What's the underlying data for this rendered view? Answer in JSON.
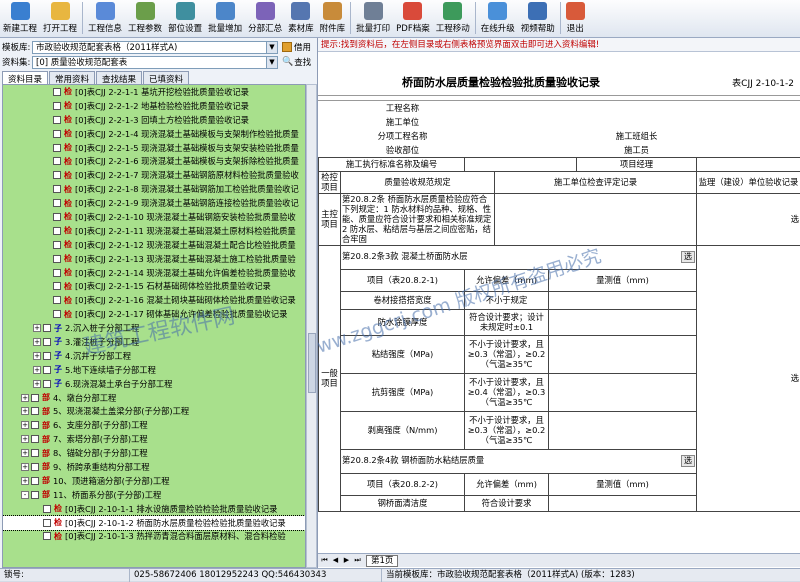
{
  "toolbar": [
    {
      "label": "新建工程",
      "icon": "new-project-icon",
      "color": "#3a7fd0"
    },
    {
      "label": "打开工程",
      "icon": "open-folder-icon",
      "color": "#e8b640"
    },
    {
      "label": "工程信息",
      "icon": "project-info-icon",
      "color": "#5a8ad8"
    },
    {
      "label": "工程参数",
      "icon": "project-params-icon",
      "color": "#6b9e4a"
    },
    {
      "label": "部位设置",
      "icon": "location-settings-icon",
      "color": "#3f8f9f"
    },
    {
      "label": "批量增加",
      "icon": "batch-add-icon",
      "color": "#4c86c9"
    },
    {
      "label": "分部汇总",
      "icon": "summary-icon",
      "color": "#7c63b8"
    },
    {
      "label": "素材库",
      "icon": "material-library-icon",
      "color": "#5576b0"
    },
    {
      "label": "附件库",
      "icon": "attachment-library-icon",
      "color": "#c88b3a"
    },
    {
      "label": "批量打印",
      "icon": "batch-print-icon",
      "color": "#6f7f96"
    },
    {
      "label": "PDF档案",
      "icon": "pdf-icon",
      "color": "#d94a3a"
    },
    {
      "label": "工程移动",
      "icon": "project-move-icon",
      "color": "#3d9a5b"
    },
    {
      "label": "在线升级",
      "icon": "online-upgrade-icon",
      "color": "#4a90d9"
    },
    {
      "label": "视频帮助",
      "icon": "video-help-icon",
      "color": "#3c6fb5"
    },
    {
      "label": "退出",
      "icon": "exit-icon",
      "color": "#d85a3a"
    }
  ],
  "template": {
    "label": "模板库:",
    "value": "市政验收规范配套表格（2011样式A)",
    "borrow": "借用"
  },
  "dataset": {
    "label": "资料集:",
    "value": "[0] 质量验收规范配套表",
    "search": "查找"
  },
  "tabs": [
    "资料目录",
    "常用资料",
    "查找结果",
    "已填资料"
  ],
  "tree": [
    {
      "indent": 50,
      "tag": "检",
      "text": "[0]表CJJ 2-2-1-1 基坑开挖检验批质量验收记录"
    },
    {
      "indent": 50,
      "tag": "检",
      "text": "[0]表CJJ 2-2-1-2 地基检验检验批质量验收记录"
    },
    {
      "indent": 50,
      "tag": "检",
      "text": "[0]表CJJ 2-2-1-3 回填土方检验批质量验收记录"
    },
    {
      "indent": 50,
      "tag": "检",
      "text": "[0]表CJJ 2-2-1-4 现浇混凝土基础模板与支架制作检验批质量"
    },
    {
      "indent": 50,
      "tag": "检",
      "text": "[0]表CJJ 2-2-1-5 现浇混凝土基础模板与支架安装检验批质量"
    },
    {
      "indent": 50,
      "tag": "检",
      "text": "[0]表CJJ 2-2-1-6 现浇混凝土基础模板与支架拆除检验批质量"
    },
    {
      "indent": 50,
      "tag": "检",
      "text": "[0]表CJJ 2-2-1-7 现浇混凝土基础钢筋原材料检验批质量验收"
    },
    {
      "indent": 50,
      "tag": "检",
      "text": "[0]表CJJ 2-2-1-8 现浇混凝土基础钢筋加工检验批质量验收记"
    },
    {
      "indent": 50,
      "tag": "检",
      "text": "[0]表CJJ 2-2-1-9 现浇混凝土基础钢筋连接检验批质量验收记"
    },
    {
      "indent": 50,
      "tag": "检",
      "text": "[0]表CJJ 2-2-1-10 现浇混凝土基础钢筋安装检验批质量验收"
    },
    {
      "indent": 50,
      "tag": "检",
      "text": "[0]表CJJ 2-2-1-11 现浇混凝土基础混凝土原材料检验批质量"
    },
    {
      "indent": 50,
      "tag": "检",
      "text": "[0]表CJJ 2-2-1-12 现浇混凝土基础混凝土配合比检验批质量"
    },
    {
      "indent": 50,
      "tag": "检",
      "text": "[0]表CJJ 2-2-1-13 现浇混凝土基础混凝土施工检验批质量验"
    },
    {
      "indent": 50,
      "tag": "检",
      "text": "[0]表CJJ 2-2-1-14 现浇混凝土基础允许偏差检验批质量验收"
    },
    {
      "indent": 50,
      "tag": "检",
      "text": "[0]表CJJ 2-2-1-15 石材基础砌体检验批质量验收记录"
    },
    {
      "indent": 50,
      "tag": "检",
      "text": "[0]表CJJ 2-2-1-16 混凝土砌块基础砌体检验批质量验收记录"
    },
    {
      "indent": 50,
      "tag": "检",
      "text": "[0]表CJJ 2-2-1-17 砌体基础允许偏差检验批质量验收记录"
    },
    {
      "indent": 30,
      "tag": "子",
      "exp": "+",
      "text": "2.沉入桩子分部工程"
    },
    {
      "indent": 30,
      "tag": "子",
      "exp": "+",
      "text": "3.灌注桩子分部工程"
    },
    {
      "indent": 30,
      "tag": "子",
      "exp": "+",
      "text": "4.沉井子分部工程"
    },
    {
      "indent": 30,
      "tag": "子",
      "exp": "+",
      "text": "5.地下连续墙子分部工程"
    },
    {
      "indent": 30,
      "tag": "子",
      "exp": "+",
      "text": "6.现浇混凝土承台子分部工程"
    },
    {
      "indent": 18,
      "tag": "部",
      "exp": "+",
      "text": "4、墩台分部工程"
    },
    {
      "indent": 18,
      "tag": "部",
      "exp": "+",
      "text": "5、现浇混凝土盖梁分部(子分部)工程"
    },
    {
      "indent": 18,
      "tag": "部",
      "exp": "+",
      "text": "6、支座分部(子分部)工程"
    },
    {
      "indent": 18,
      "tag": "部",
      "exp": "+",
      "text": "7、索塔分部(子分部)工程"
    },
    {
      "indent": 18,
      "tag": "部",
      "exp": "+",
      "text": "8、锚碇分部(子分部)工程"
    },
    {
      "indent": 18,
      "tag": "部",
      "exp": "+",
      "text": "9、桥跨承重结构分部工程"
    },
    {
      "indent": 18,
      "tag": "部",
      "exp": "+",
      "text": "10、顶进箱涵分部(子分部)工程"
    },
    {
      "indent": 18,
      "tag": "部",
      "exp": "-",
      "text": "11、桥面系分部(子分部)工程"
    },
    {
      "indent": 40,
      "tag": "检",
      "text": "[0]表CJJ 2-10-1-1 排水设施质量检验检验批质量验收记录"
    },
    {
      "indent": 40,
      "tag": "检",
      "text": "[0]表CJJ 2-10-1-2 桥面防水层质量检验检验批质量验收记录",
      "hl": true
    },
    {
      "indent": 40,
      "tag": "检",
      "text": "[0]表CJJ 2-10-1-3 热拌沥青混合料面层原材料、混合料检验"
    }
  ],
  "hint": {
    "label": "提示:",
    "text": "找到资料后，在左侧目录或右侧表格预览界面双击即可进入资料编辑!"
  },
  "doc": {
    "title": "桥面防水层质量检验检验批质量验收记录",
    "code": "表CJJ 2-10-1-2",
    "project_name": "工程名称",
    "builder": "施工单位",
    "subproject": "分项工程名称",
    "team_leader": "施工班组长",
    "inspect_part": "验收部位",
    "foreman": "施工员",
    "standard": "施工执行标准名称及编号",
    "pm": "项目经理",
    "h_item": "检控项目",
    "h_norm": "质量验收规范规定",
    "h_check": "施工单位检查评定记录",
    "h_sup": "监理（建设）单位验收记录",
    "main_ctrl": "主控项目",
    "main_text": "第20.8.2条 桥面防水层质量检验应符合下列规定：1 防水材料的品种、规格、性能、质量应符合设计要求和相关标准规定 2 防水层、粘结层与基层之间应密贴，结合牢固",
    "sel": "选",
    "sec3": "第20.8.2条3款 混凝土桥面防水层",
    "item_tbl1": "项目（表20.8.2-1)",
    "tol": "允许偏差（mm)",
    "measured": "量测值（mm)",
    "general": "一般项目",
    "r1": "卷材接搭搭宽度",
    "r1v": "不小于规定",
    "r2": "防水涂膜厚度",
    "r2v": "符合设计要求；设计未规定时±0.1",
    "r3": "粘结强度（MPa)",
    "r3v": "不小于设计要求，且≥0.3（常温），≥0.2（气温≥35℃",
    "r4": "抗剪强度（MPa)",
    "r4v": "不小于设计要求，且≥0.4（常温），≥0.3（气温≥35℃",
    "r5": "剥离强度（N/mm)",
    "r5v": "不小于设计要求，且≥0.3（常温），≥0.2（气温≥35℃",
    "sec4": "第20.8.2条4款 钢桥面防水粘结层质量",
    "item_tbl2": "项目（表20.8.2-2)",
    "r6": "钢桥面清洁度",
    "r6v": "符合设计要求",
    "sheet_tab": "第1页"
  },
  "status": {
    "lock": "锁号:",
    "phone": "025-58672406 18012952243 QQ:546430343",
    "current": "当前模板库：市政验收规范配套表格（2011样式A)  (版本：1283)"
  },
  "watermark": {
    "w1": "建筑工程软件网",
    "w2": "www.zggcrj.com 版权所有盗用必究"
  }
}
